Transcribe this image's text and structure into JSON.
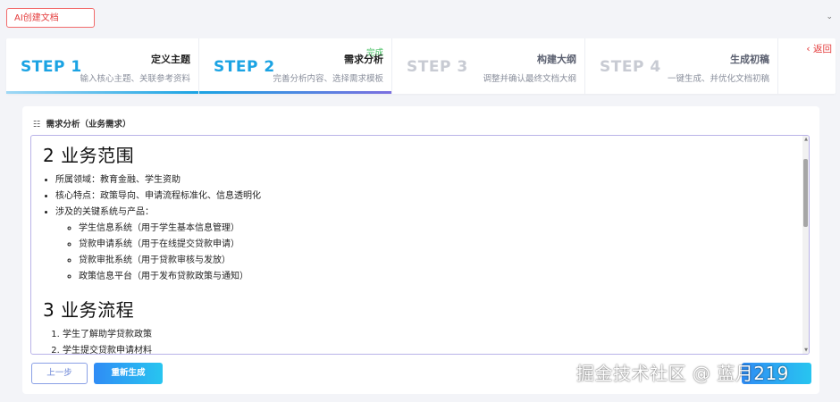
{
  "header": {
    "ai_create_label": "AI创建文档",
    "collapse_icon": "chevron-down"
  },
  "steps": [
    {
      "num": "STEP 1",
      "title": "定义主题",
      "desc": "输入核心主题、关联参考资料",
      "status": "done"
    },
    {
      "num": "STEP 2",
      "title": "需求分析",
      "desc": "完善分析内容、选择需求模板",
      "status": "active",
      "badge": "完成"
    },
    {
      "num": "STEP 3",
      "title": "构建大纲",
      "desc": "调整并确认最终文档大纲",
      "status": "pending"
    },
    {
      "num": "STEP 4",
      "title": "生成初稿",
      "desc": "一键生成、并优化文档初稿",
      "status": "pending"
    }
  ],
  "back": {
    "arrow": "‹",
    "label": "返回"
  },
  "section": {
    "icon": "☷",
    "label": "需求分析（业务需求）"
  },
  "editor": {
    "heading1": "2 业务范围",
    "scope_items": [
      "所属领域：教育金融、学生资助",
      "核心特点：政策导向、申请流程标准化、信息透明化",
      "涉及的关键系统与产品："
    ],
    "systems": [
      "学生信息系统（用于学生基本信息管理）",
      "贷款申请系统（用于在线提交贷款申请）",
      "贷款审批系统（用于贷款审核与发放）",
      "政策信息平台（用于发布贷款政策与通知）"
    ],
    "heading2": "3 业务流程",
    "process_steps": [
      "学生了解助学贷款政策",
      "学生提交贷款申请材料"
    ]
  },
  "buttons": {
    "prev": "上一步",
    "regenerate": "重新生成"
  },
  "watermark": "掘金技术社区 @ 蓝月219",
  "colors": {
    "accent": "#1ba3e3",
    "danger": "#e43c3c",
    "success": "#3fbd5c",
    "editor_border": "#b9b3e8"
  }
}
